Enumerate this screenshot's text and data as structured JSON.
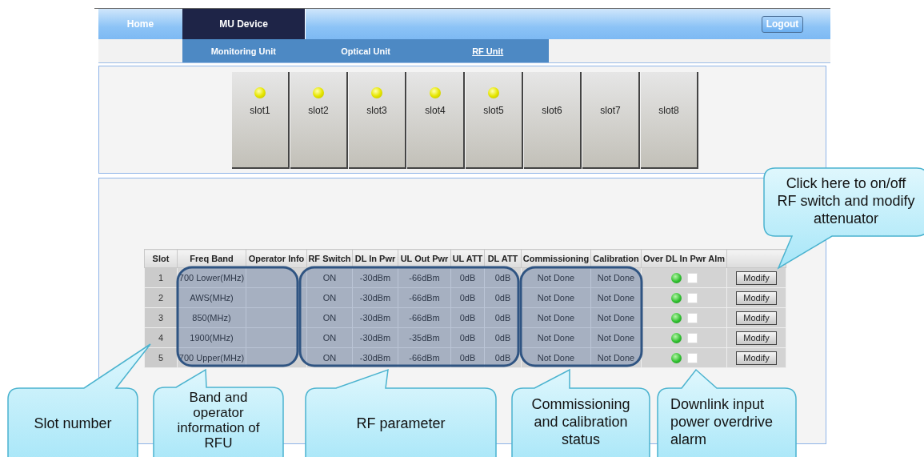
{
  "nav": {
    "tabs": [
      {
        "label": "Home",
        "selected": false
      },
      {
        "label": "MU Device",
        "selected": true
      }
    ],
    "logout": "Logout"
  },
  "subnav": [
    {
      "label": "Monitoring Unit",
      "selected": false
    },
    {
      "label": "Optical Unit",
      "selected": false
    },
    {
      "label": "RF Unit",
      "selected": true
    }
  ],
  "slots": [
    {
      "label": "slot1",
      "led": true
    },
    {
      "label": "slot2",
      "led": true
    },
    {
      "label": "slot3",
      "led": true
    },
    {
      "label": "slot4",
      "led": true
    },
    {
      "label": "slot5",
      "led": true
    },
    {
      "label": "slot6",
      "led": false
    },
    {
      "label": "slot7",
      "led": false
    },
    {
      "label": "slot8",
      "led": false
    }
  ],
  "table": {
    "columns": [
      "Slot",
      "Freq Band",
      "Operator Info",
      "RF Switch",
      "DL In Pwr",
      "UL Out Pwr",
      "UL ATT",
      "DL ATT",
      "Commissioning",
      "Calibration",
      "Over DL In Pwr Alm"
    ],
    "rows": [
      {
        "slot": "1",
        "freq_band": "700 Lower(MHz)",
        "rf_switch": "ON",
        "dl_in_pwr": "-30dBm",
        "ul_out_pwr": "-66dBm",
        "ul_att": "0dB",
        "dl_att": "0dB",
        "commissioning": "Not Done",
        "calibration": "Not Done",
        "alarm_active": false,
        "checked": false,
        "button": "Modify"
      },
      {
        "slot": "2",
        "freq_band": "AWS(MHz)",
        "rf_switch": "ON",
        "dl_in_pwr": "-30dBm",
        "ul_out_pwr": "-66dBm",
        "ul_att": "0dB",
        "dl_att": "0dB",
        "commissioning": "Not Done",
        "calibration": "Not Done",
        "alarm_active": false,
        "checked": false,
        "button": "Modify"
      },
      {
        "slot": "3",
        "freq_band": "850(MHz)",
        "rf_switch": "ON",
        "dl_in_pwr": "-30dBm",
        "ul_out_pwr": "-66dBm",
        "ul_att": "0dB",
        "dl_att": "0dB",
        "commissioning": "Not Done",
        "calibration": "Not Done",
        "alarm_active": false,
        "checked": false,
        "button": "Modify"
      },
      {
        "slot": "4",
        "freq_band": "1900(MHz)",
        "rf_switch": "ON",
        "dl_in_pwr": "-30dBm",
        "ul_out_pwr": "-35dBm",
        "ul_att": "0dB",
        "dl_att": "0dB",
        "commissioning": "Not Done",
        "calibration": "Not Done",
        "alarm_active": false,
        "checked": false,
        "button": "Modify"
      },
      {
        "slot": "5",
        "freq_band": "700 Upper(MHz)",
        "rf_switch": "ON",
        "dl_in_pwr": "-30dBm",
        "ul_out_pwr": "-66dBm",
        "ul_att": "0dB",
        "dl_att": "0dB",
        "commissioning": "Not Done",
        "calibration": "Not Done",
        "alarm_active": false,
        "checked": false,
        "button": "Modify"
      }
    ]
  },
  "callouts": [
    {
      "text": "Slot number"
    },
    {
      "text": "Band and operator information of RFU"
    },
    {
      "text": "RF parameter"
    },
    {
      "text": "Commissioning and calibration status"
    },
    {
      "text": "Downlink input power overdrive alarm"
    },
    {
      "text": "Click here to on/off RF switch and modify attenuator"
    }
  ]
}
